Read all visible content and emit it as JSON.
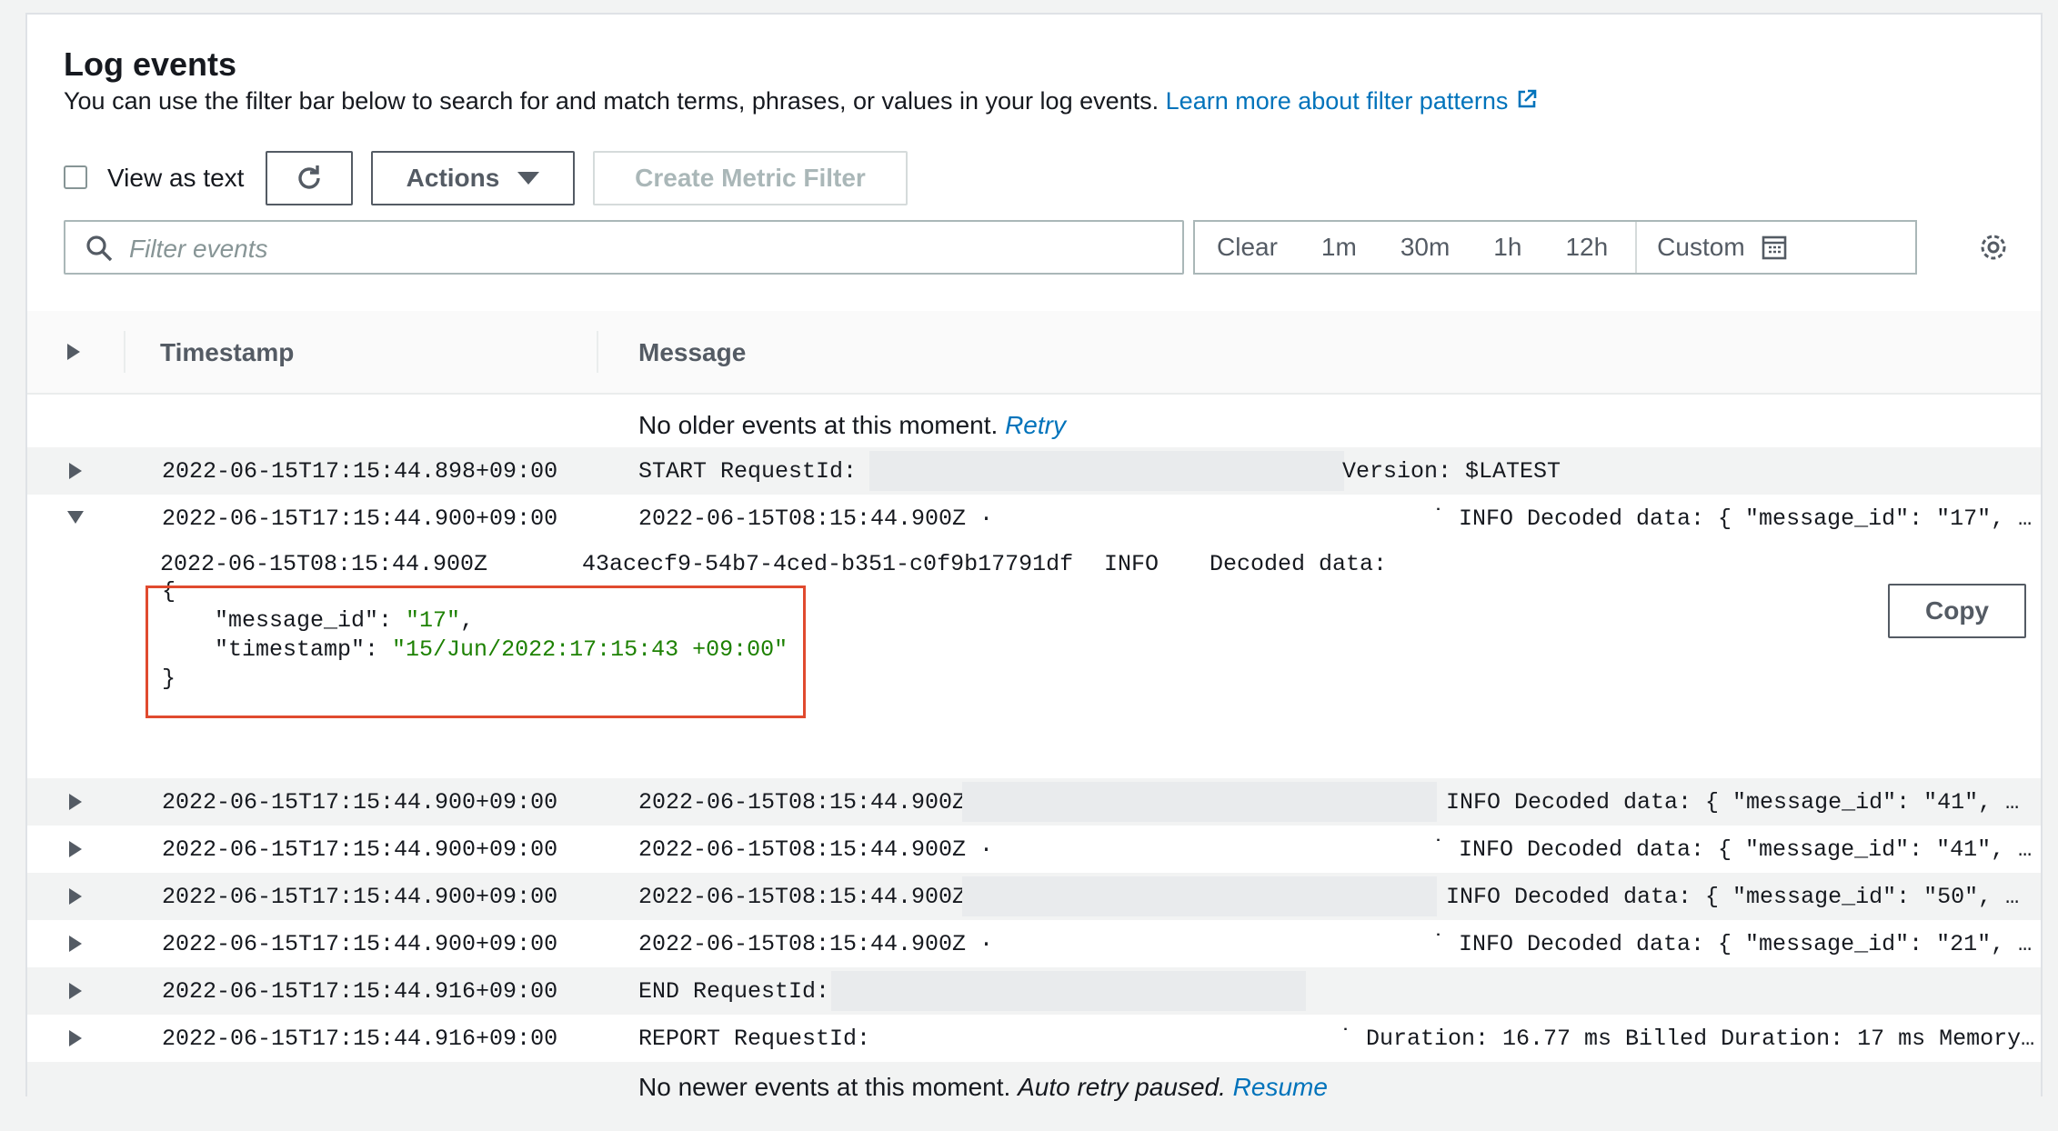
{
  "header": {
    "title": "Log events",
    "description": "You can use the filter bar below to search for and match terms, phrases, or values in your log events.",
    "learn_more": "Learn more about filter patterns"
  },
  "toolbar": {
    "view_as_text": "View as text",
    "actions": "Actions",
    "create_metric_filter": "Create Metric Filter"
  },
  "search": {
    "placeholder": "Filter events"
  },
  "time_range": {
    "clear": "Clear",
    "m1": "1m",
    "m30": "30m",
    "h1": "1h",
    "h12": "12h",
    "custom": "Custom"
  },
  "table": {
    "col_timestamp": "Timestamp",
    "col_message": "Message",
    "older": {
      "text": "No older events at this moment.",
      "link": "Retry"
    },
    "newer": {
      "text": "No newer events at this moment.",
      "italic": "Auto retry paused.",
      "link": "Resume"
    },
    "rows": [
      {
        "ts": "2022-06-15T17:15:44.898+09:00",
        "msg1": "START RequestId: 4",
        "msg2": "Version: $LATEST"
      },
      {
        "ts": "2022-06-15T17:15:44.900+09:00",
        "msg1": "2022-06-15T08:15:44.900Z ·",
        "msg2": "˙ INFO Decoded data: { \"message_id\": \"17\", …"
      },
      {
        "ts": "2022-06-15T17:15:44.900+09:00",
        "msg1": "2022-06-15T08:15:44.900Z",
        "msg2": "INFO Decoded data: { \"message_id\": \"41\", …"
      },
      {
        "ts": "2022-06-15T17:15:44.900+09:00",
        "msg1": "2022-06-15T08:15:44.900Z ·",
        "msg2": "˙ INFO Decoded data: { \"message_id\": \"41\", …"
      },
      {
        "ts": "2022-06-15T17:15:44.900+09:00",
        "msg1": "2022-06-15T08:15:44.900Z",
        "msg2": "INFO Decoded data: { \"message_id\": \"50\", …"
      },
      {
        "ts": "2022-06-15T17:15:44.900+09:00",
        "msg1": "2022-06-15T08:15:44.900Z ·",
        "msg2": "˙ INFO Decoded data: { \"message_id\": \"21\", …"
      },
      {
        "ts": "2022-06-15T17:15:44.916+09:00",
        "msg1": "END RequestId:",
        "msg2": ""
      },
      {
        "ts": "2022-06-15T17:15:44.916+09:00",
        "msg1": "REPORT RequestId:",
        "msg2": "˙ Duration: 16.77 ms Billed Duration: 17 ms Memory…"
      }
    ]
  },
  "expanded": {
    "header_ts": "2022-06-15T08:15:44.900Z",
    "header_id": "43acecf9-54b7-4ced-b351-c0f9b17791df",
    "header_level": "INFO",
    "header_msg": "Decoded data:",
    "open_brace": "{",
    "key1": "\"message_id\": ",
    "val1": "\"17\"",
    "comma": ",",
    "key2": "\"timestamp\": ",
    "val2": "\"15/Jun/2022:17:15:43 +09:00\"",
    "close_brace": "}",
    "copy": "Copy"
  },
  "colors": {
    "link": "#0073bb",
    "json_string": "#1d8102",
    "highlight": "#e04a2f"
  }
}
